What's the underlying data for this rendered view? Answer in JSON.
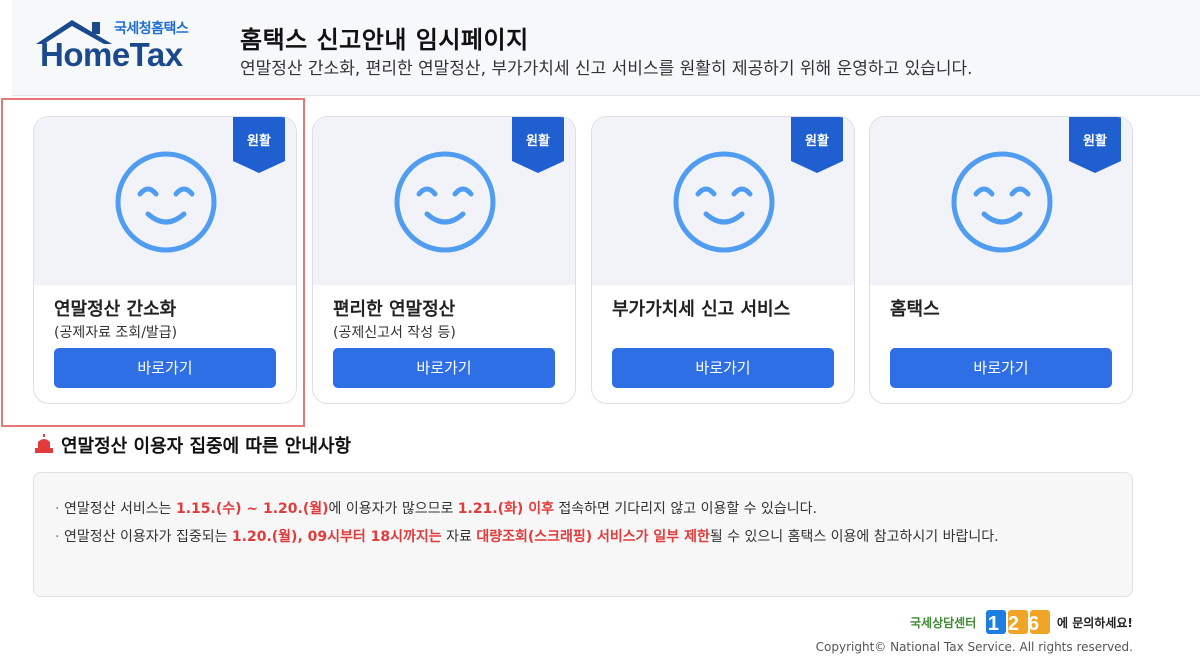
{
  "brand": {
    "logo_kr": "국세청홈택스",
    "logo_en": "HomeTax"
  },
  "header": {
    "title": "홈택스 신고안내 임시페이지",
    "subtitle": "연말정산 간소화, 편리한 연말정산, 부가가치세 신고 서비스를 원활히 제공하기 위해 운영하고 있습니다."
  },
  "cards": [
    {
      "status": "원활",
      "name": "연말정산 간소화",
      "desc": "(공제자료 조회/발급)",
      "button": "바로가기"
    },
    {
      "status": "원활",
      "name": "편리한 연말정산",
      "desc": "(공제신고서 작성 등)",
      "button": "바로가기"
    },
    {
      "status": "원활",
      "name": "부가가치세 신고 서비스",
      "desc": "",
      "button": "바로가기"
    },
    {
      "status": "원활",
      "name": "홈택스",
      "desc": "",
      "button": "바로가기"
    }
  ],
  "notice": {
    "title": "연말정산 이용자 집중에 따른 안내사항",
    "line1": {
      "t1": "연말정산 서비스는 ",
      "r1": "1.15.(수) ~ 1.20.(월)",
      "t2": "에 이용자가 많으므로 ",
      "r2": "1.21.(화) 이후",
      "t3": " 접속하면 기다리지 않고 이용할 수 있습니다."
    },
    "line2": {
      "t1": "연말정산 이용자가 집중되는 ",
      "r1": "1.20.(월), 09시부터 18시까지는",
      "t2": " 자료 ",
      "r2": "대량조회(스크래핑) 서비스가 일부 제한",
      "t3": "될 수 있으니 홈택스 이용에 참고하시기 바랍니다."
    }
  },
  "footer": {
    "callcenter_label": "국세상담센터",
    "callcenter_number": "126",
    "callcenter_suffix": "에 문의하세요!",
    "copyright": "Copyright© National Tax Service. All rights reserved."
  },
  "colors": {
    "accent": "#2f6fe6",
    "badge": "#1f5fd0",
    "highlight_text": "#e03c3c",
    "selection_border": "#e7787a"
  }
}
